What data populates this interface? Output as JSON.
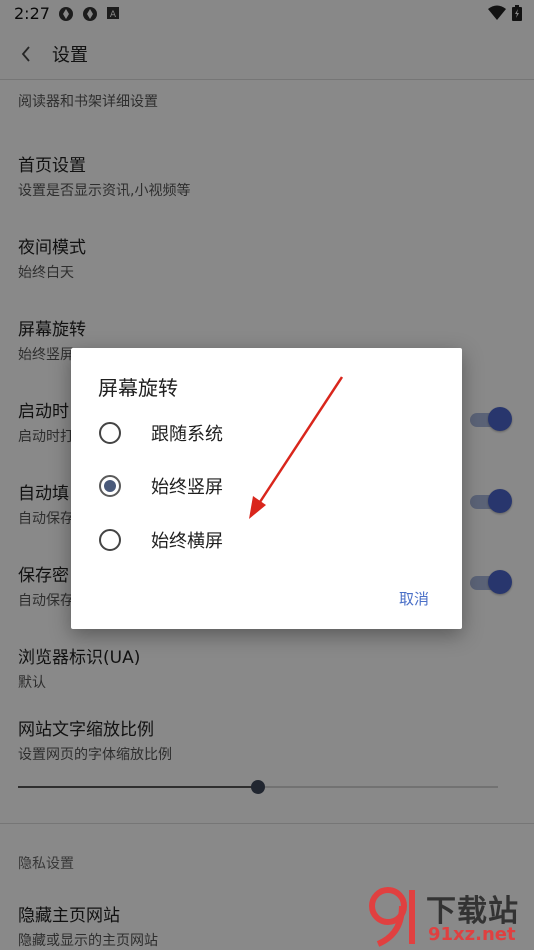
{
  "status_bar": {
    "time": "2:27"
  },
  "app_bar": {
    "title": "设置"
  },
  "settings": {
    "partial_item_sub": "阅读器和书架详细设置",
    "items": [
      {
        "title": "首页设置",
        "subtitle": "设置是否显示资讯,小视频等"
      },
      {
        "title": "夜间模式",
        "subtitle": "始终白天"
      },
      {
        "title": "屏幕旋转",
        "subtitle": "始终竖屏"
      },
      {
        "title": "启动时",
        "subtitle": "启动时打"
      },
      {
        "title": "自动填",
        "subtitle": "自动保存"
      },
      {
        "title": "保存密",
        "subtitle": "自动保存"
      },
      {
        "title": "浏览器标识(UA)",
        "subtitle": "默认"
      },
      {
        "title": "网站文字缩放比例",
        "subtitle": "设置网页的字体缩放比例"
      }
    ],
    "text_scale_slider": {
      "value_fraction": 0.5
    },
    "section_privacy": "隐私设置",
    "privacy_items": [
      {
        "title": "隐藏主页网站",
        "subtitle": "隐藏或显示的主页网站"
      }
    ]
  },
  "dialog": {
    "title": "屏幕旋转",
    "options": [
      {
        "label": "跟随系统",
        "selected": false
      },
      {
        "label": "始终竖屏",
        "selected": true
      },
      {
        "label": "始终横屏",
        "selected": false
      }
    ],
    "cancel_label": "取消"
  },
  "watermark": {
    "text_top": "下载站",
    "text_bottom": "91xz.net"
  },
  "colors": {
    "accent": "#4a63c7",
    "arrow": "#d9261c",
    "cancel": "#4a6fc7"
  }
}
